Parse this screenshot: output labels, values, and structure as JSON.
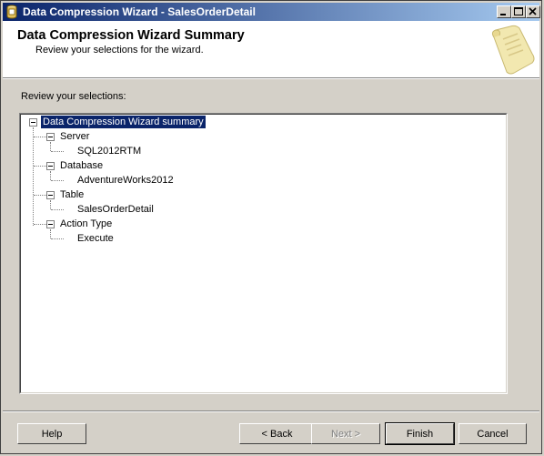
{
  "window": {
    "title": "Data Compression Wizard - SalesOrderDetail"
  },
  "header": {
    "title": "Data Compression Wizard Summary",
    "subtitle": "Review your selections for the wizard."
  },
  "review_label": "Review your selections:",
  "tree": {
    "root": "Data Compression Wizard summary",
    "nodes": [
      {
        "label": "Server",
        "child": "SQL2012RTM"
      },
      {
        "label": "Database",
        "child": "AdventureWorks2012"
      },
      {
        "label": "Table",
        "child": "SalesOrderDetail"
      },
      {
        "label": "Action Type",
        "child": "Execute"
      }
    ]
  },
  "buttons": {
    "help": "Help",
    "back": "< Back",
    "next": "Next >",
    "finish": "Finish",
    "cancel": "Cancel"
  },
  "colors": {
    "title_bar": "#0a246a",
    "selection": "#0a246a",
    "face": "#d4d0c8"
  }
}
